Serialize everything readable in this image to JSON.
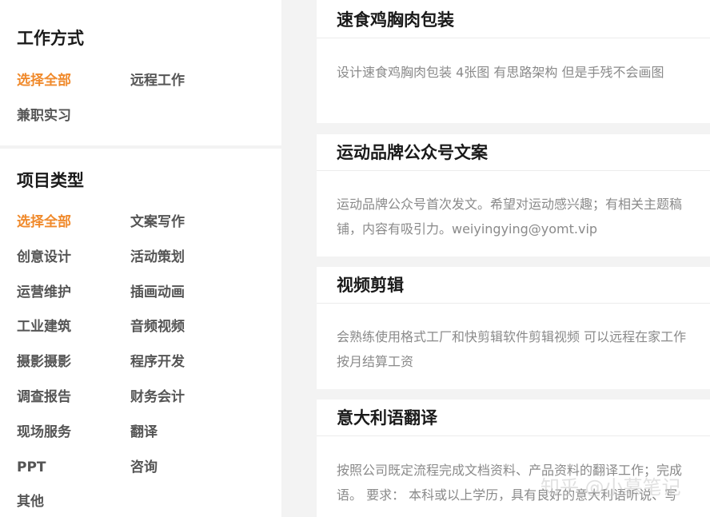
{
  "filters": {
    "work_mode": {
      "title": "工作方式",
      "options": [
        {
          "label": "选择全部",
          "active": true
        },
        {
          "label": "远程工作",
          "active": false
        },
        {
          "label": "兼职实习",
          "active": false
        }
      ]
    },
    "project_type": {
      "title": "项目类型",
      "options": [
        {
          "label": "选择全部",
          "active": true
        },
        {
          "label": "文案写作",
          "active": false
        },
        {
          "label": "创意设计",
          "active": false
        },
        {
          "label": "活动策划",
          "active": false
        },
        {
          "label": "运营维护",
          "active": false
        },
        {
          "label": "插画动画",
          "active": false
        },
        {
          "label": "工业建筑",
          "active": false
        },
        {
          "label": "音频视频",
          "active": false
        },
        {
          "label": "摄影摄影",
          "active": false
        },
        {
          "label": "程序开发",
          "active": false
        },
        {
          "label": "调查报告",
          "active": false
        },
        {
          "label": "财务会计",
          "active": false
        },
        {
          "label": "现场服务",
          "active": false
        },
        {
          "label": "翻译",
          "active": false
        },
        {
          "label": "PPT",
          "active": false
        },
        {
          "label": "咨询",
          "active": false
        },
        {
          "label": "其他",
          "active": false
        }
      ]
    }
  },
  "jobs": [
    {
      "title": "速食鸡胸肉包装",
      "desc": [
        "设计速食鸡胸肉包装 4张图 有思路架构 但是手残不会画图"
      ]
    },
    {
      "title": "运动品牌公众号文案",
      "desc": [
        "运动品牌公众号首次发文。希望对运动感兴趣；有相关主题稿",
        "铺，内容有吸引力。weiyingying@yomt.vip"
      ]
    },
    {
      "title": "视频剪辑",
      "desc": [
        "会熟练使用格式工厂和快剪辑软件剪辑视频 可以远程在家工作",
        "按月结算工资"
      ]
    },
    {
      "title": "意大利语翻译",
      "desc": [
        "按照公司既定流程完成文档资料、产品资料的翻译工作；完成",
        "语。 要求： 本科或以上学历，具有良好的意大利语听说、写"
      ]
    }
  ],
  "watermark": "知乎 @小慕笔记",
  "colors": {
    "accent": "#f08a2c",
    "background": "#f3f3f3",
    "card": "#ffffff"
  }
}
